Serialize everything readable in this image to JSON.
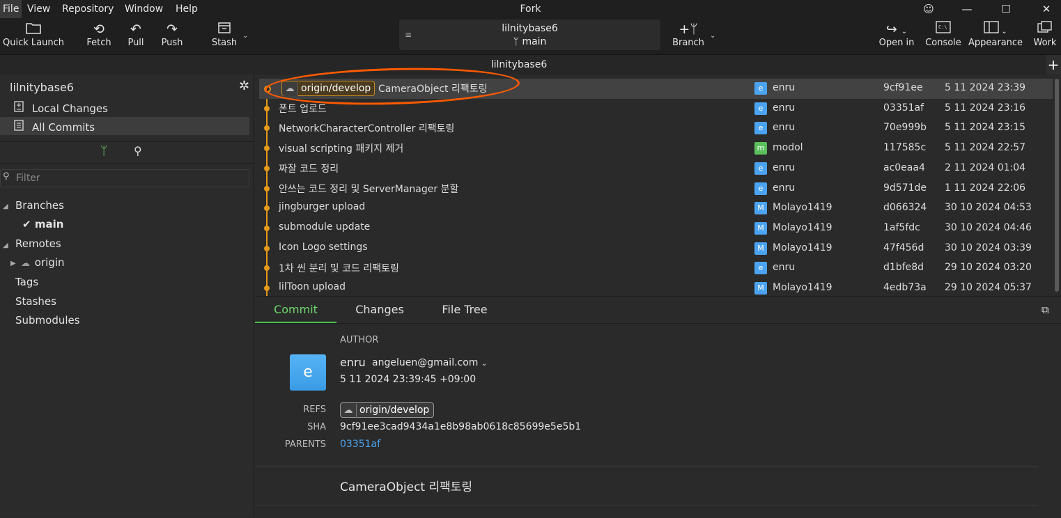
{
  "app_title": "Fork",
  "menu": [
    "File",
    "View",
    "Repository",
    "Window",
    "Help"
  ],
  "window_controls": {
    "feedback": "☺",
    "minimize": "—",
    "maximize": "☐",
    "close": "✕"
  },
  "toolbar": {
    "quick_launch": "Quick Launch",
    "fetch": "Fetch",
    "pull": "Pull",
    "push": "Push",
    "stash": "Stash",
    "repo_name": "lilnitybase6",
    "branch_name": "main",
    "branch": "Branch",
    "open_in": "Open in",
    "console": "Console",
    "appearance": "Appearance",
    "work": "Work"
  },
  "tab": {
    "repo": "lilnitybase6",
    "add": "+"
  },
  "sidebar": {
    "repo_title": "lilnitybase6",
    "local_changes": "Local Changes",
    "all_commits": "All Commits",
    "filter_placeholder": "Filter",
    "branches": "Branches",
    "current_branch": "main",
    "remotes": "Remotes",
    "origin": "origin",
    "tags": "Tags",
    "stashes": "Stashes",
    "submodules": "Submodules"
  },
  "commits": [
    {
      "ref": "origin/develop",
      "message": "CameraObject 리팩토링",
      "avatar": "e",
      "avatar_color": "#4ba3f2",
      "author": "enru",
      "sha": "9cf91ee",
      "date": "5 11 2024 23:39"
    },
    {
      "message": "폰트 업로드",
      "avatar": "e",
      "avatar_color": "#4ba3f2",
      "author": "enru",
      "sha": "03351af",
      "date": "5 11 2024 23:16"
    },
    {
      "message": "NetworkCharacterController 리팩토링",
      "avatar": "e",
      "avatar_color": "#4ba3f2",
      "author": "enru",
      "sha": "70e999b",
      "date": "5 11 2024 23:15"
    },
    {
      "message": "visual scripting 패키지 제거",
      "avatar": "m",
      "avatar_color": "#5cbf5c",
      "author": "modol",
      "sha": "117585c",
      "date": "5 11 2024 22:57"
    },
    {
      "message": "짜잘 코드 정리",
      "avatar": "e",
      "avatar_color": "#4ba3f2",
      "author": "enru",
      "sha": "ac0eaa4",
      "date": "2 11 2024 01:04"
    },
    {
      "message": "안쓰는 코드 정리 및 ServerManager 분할",
      "avatar": "e",
      "avatar_color": "#4ba3f2",
      "author": "enru",
      "sha": "9d571de",
      "date": "1 11 2024 22:06"
    },
    {
      "message": "jingburger upload",
      "avatar": "M",
      "avatar_color": "#4ba3f2",
      "author": "Molayo1419",
      "sha": "d066324",
      "date": "30 10 2024 04:53"
    },
    {
      "message": "submodule update",
      "avatar": "M",
      "avatar_color": "#4ba3f2",
      "author": "Molayo1419",
      "sha": "1af5fdc",
      "date": "30 10 2024 04:46"
    },
    {
      "message": "Icon Logo settings",
      "avatar": "M",
      "avatar_color": "#4ba3f2",
      "author": "Molayo1419",
      "sha": "47f456d",
      "date": "30 10 2024 03:39"
    },
    {
      "message": "1차 씬 분리 및 코드 리팩토링",
      "avatar": "e",
      "avatar_color": "#4ba3f2",
      "author": "enru",
      "sha": "d1bfe8d",
      "date": "29 10 2024 03:20"
    },
    {
      "message": "lilToon upload",
      "avatar": "M",
      "avatar_color": "#4ba3f2",
      "author": "Molayo1419",
      "sha": "4edb73a",
      "date": "29 10 2024 05:37"
    }
  ],
  "details": {
    "tabs": [
      "Commit",
      "Changes",
      "File Tree"
    ],
    "author_label": "AUTHOR",
    "author_name": "enru",
    "author_email": "angeluen@gmail.com",
    "author_avatar": "e",
    "author_date": "5 11 2024 23:39:45 +09:00",
    "refs_label": "REFS",
    "ref": "origin/develop",
    "sha_label": "SHA",
    "sha": "9cf91ee3cad9434a1e8b98ab0618c85699e5e5b1",
    "parents_label": "PARENTS",
    "parent": "03351af",
    "message": "CameraObject 리팩토링"
  },
  "colors": {
    "accent_green": "#4cc44c",
    "graph_orange": "#e69a1a",
    "link_blue": "#4aa3f0",
    "annotation": "#ff5a00"
  }
}
